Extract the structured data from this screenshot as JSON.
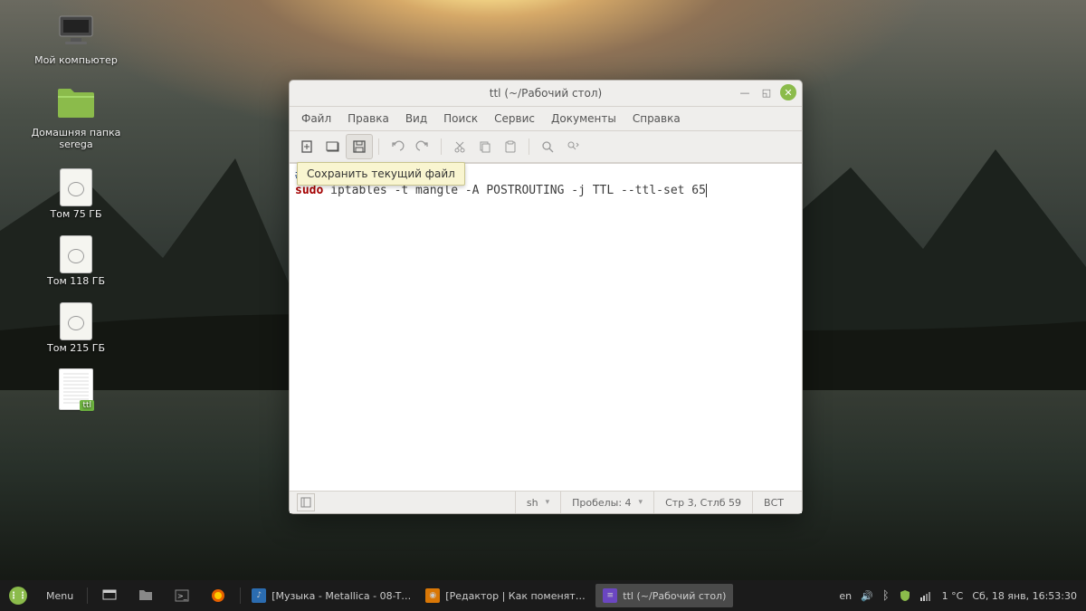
{
  "desktop_icons": {
    "computer": "Мой компьютер",
    "home": "Домашняя папка\nserega",
    "drive1": "Том 75 ГБ",
    "drive2": "Том 118 ГБ",
    "drive3": "Том 215 ГБ",
    "file_tag": "ttl",
    "file_label": ""
  },
  "window": {
    "title": "ttl (~/Рабочий стол)",
    "tooltip": "Сохранить текущий файл",
    "menu": [
      "Файл",
      "Правка",
      "Вид",
      "Поиск",
      "Сервис",
      "Документы",
      "Справка"
    ],
    "code": {
      "line1_kw": "#!/bin/bash",
      "line2_kw": "sudo",
      "line2_rest": " iptables -t mangle -A POSTROUTING -j TTL --ttl-set 65"
    },
    "status": {
      "lang": "sh",
      "spaces": "Пробелы: 4",
      "pos": "Стр 3, Стлб 59",
      "ins": "ВСТ"
    }
  },
  "panel": {
    "menu_label": "Menu",
    "task_music": "[Музыка - Metallica - 08-T…",
    "task_browser": "[Редактор | Как поменять…",
    "task_editor": "ttl (~/Рабочий стол)",
    "lang": "en",
    "temp": "1 °C",
    "clock": "Сб, 18 янв, 16:53:30"
  },
  "colors": {
    "accent": "#8bbb4b"
  }
}
